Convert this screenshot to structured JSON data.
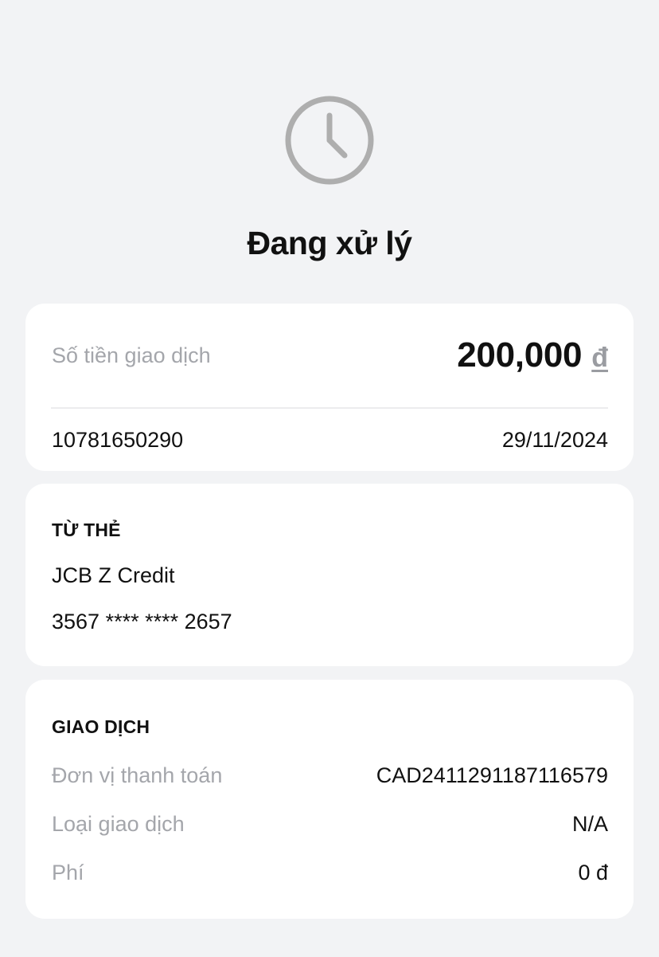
{
  "status": {
    "icon": "clock-icon",
    "title": "Đang xử lý",
    "icon_color": "#aeaeae"
  },
  "amount_card": {
    "label": "Số tiền giao dịch",
    "amount": "200,000",
    "currency": "đ",
    "transaction_id": "10781650290",
    "date": "29/11/2024"
  },
  "source_card": {
    "heading": "TỪ THẺ",
    "card_name": "JCB Z Credit",
    "card_number": "3567 **** **** 2657"
  },
  "transaction_card": {
    "heading": "GIAO DỊCH",
    "rows": [
      {
        "label": "Đơn vị thanh toán",
        "value": "CAD2411291187116579"
      },
      {
        "label": "Loại giao dịch",
        "value": "N/A"
      },
      {
        "label": "Phí",
        "value": "0 đ"
      }
    ]
  },
  "colors": {
    "background": "#f2f3f5",
    "card": "#ffffff",
    "muted_text": "#a4a6ab",
    "primary_text": "#111111"
  }
}
